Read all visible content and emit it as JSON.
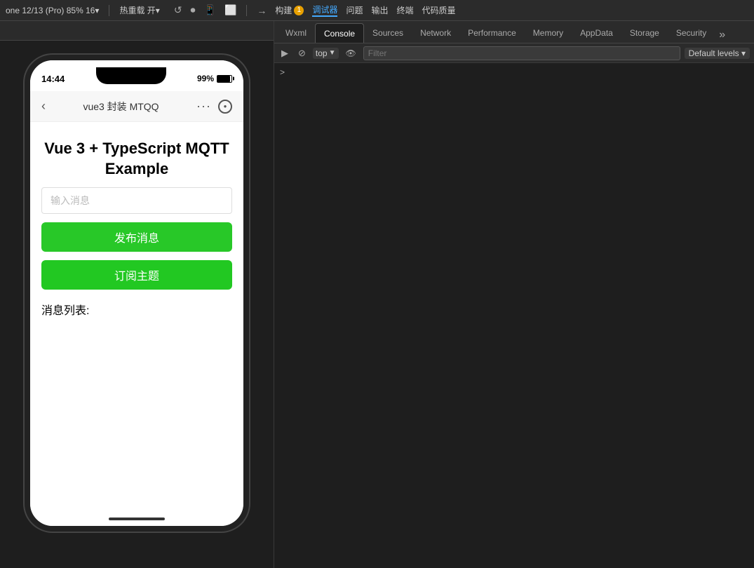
{
  "toolbar": {
    "project": "one 12/13 (Pro) 85% 16▾",
    "hot_reload": "热重载 开▾",
    "build": "构建",
    "build_badge": "1",
    "debugger": "调试器",
    "problems": "问题",
    "output": "输出",
    "terminal": "终端",
    "code_quality": "代码质量"
  },
  "phone": {
    "status_time": "14:44",
    "battery_percent": "99%",
    "nav_title": "vue3 封装 MTQQ",
    "app_title": "Vue 3 + TypeScript MQTT\nExample",
    "input_placeholder": "输入消息",
    "publish_btn": "发布消息",
    "subscribe_btn": "订阅主题",
    "message_list_label": "消息列表:"
  },
  "devtools": {
    "tabs": [
      {
        "label": "Wxml",
        "active": false
      },
      {
        "label": "Console",
        "active": true
      },
      {
        "label": "Sources",
        "active": false
      },
      {
        "label": "Network",
        "active": false
      },
      {
        "label": "Performance",
        "active": false
      },
      {
        "label": "Memory",
        "active": false
      },
      {
        "label": "AppData",
        "active": false
      },
      {
        "label": "Storage",
        "active": false
      },
      {
        "label": "Security",
        "active": false
      }
    ],
    "more_icon": "»",
    "console": {
      "execute_icon": "▶",
      "block_icon": "⊘",
      "context_label": "top",
      "eye_icon": "👁",
      "filter_placeholder": "Filter",
      "log_level": "Default levels ▾",
      "arrow": ">"
    }
  }
}
